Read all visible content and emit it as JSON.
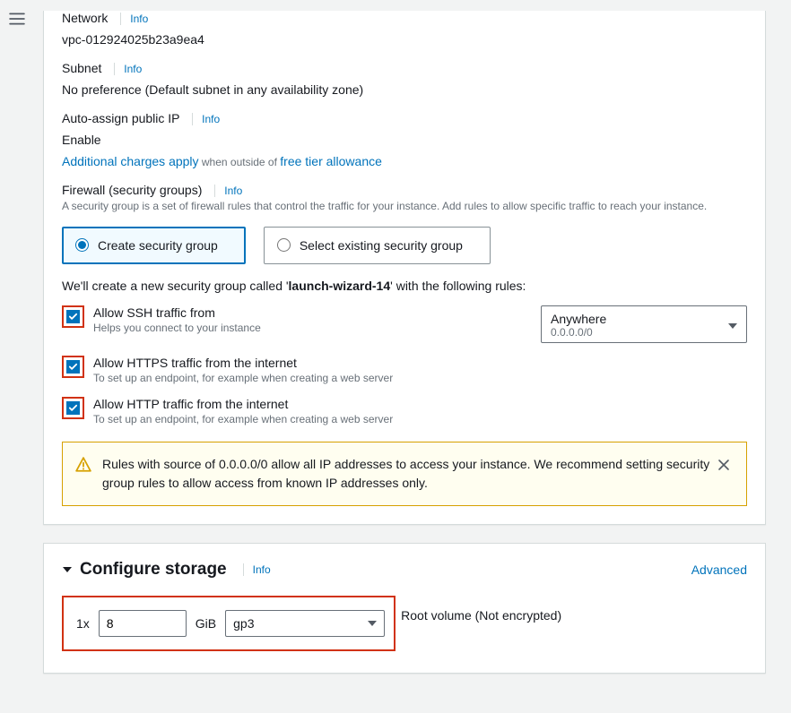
{
  "network": {
    "label": "Network",
    "info": "Info",
    "value": "vpc-012924025b23a9ea4"
  },
  "subnet": {
    "label": "Subnet",
    "info": "Info",
    "value": "No preference (Default subnet in any availability zone)"
  },
  "autoIp": {
    "label": "Auto-assign public IP",
    "info": "Info",
    "value": "Enable"
  },
  "charges": {
    "link1": "Additional charges apply",
    "middle": " when outside of ",
    "link2": "free tier allowance"
  },
  "firewall": {
    "label": "Firewall (security groups)",
    "info": "Info",
    "help": "A security group is a set of firewall rules that control the traffic for your instance. Add rules to allow specific traffic to reach your instance."
  },
  "radios": {
    "create": "Create security group",
    "select": "Select existing security group"
  },
  "sgMessage": {
    "pre": "We'll create a new security group called '",
    "name": "launch-wizard-14",
    "post": "' with the following rules:"
  },
  "ssh": {
    "label": "Allow SSH traffic from",
    "help": "Helps you connect to your instance",
    "selectPrimary": "Anywhere",
    "selectSecondary": "0.0.0.0/0"
  },
  "https": {
    "label": "Allow HTTPS traffic from the internet",
    "help": "To set up an endpoint, for example when creating a web server"
  },
  "http": {
    "label": "Allow HTTP traffic from the internet",
    "help": "To set up an endpoint, for example when creating a web server"
  },
  "alert": {
    "text": "Rules with source of 0.0.0.0/0 allow all IP addresses to access your instance. We recommend setting security group rules to allow access from known IP addresses only."
  },
  "storage": {
    "title": "Configure storage",
    "info": "Info",
    "advanced": "Advanced",
    "mult": "1x",
    "size": "8",
    "gib": "GiB",
    "type": "gp3",
    "rootVol": "Root volume  (Not encrypted)"
  }
}
